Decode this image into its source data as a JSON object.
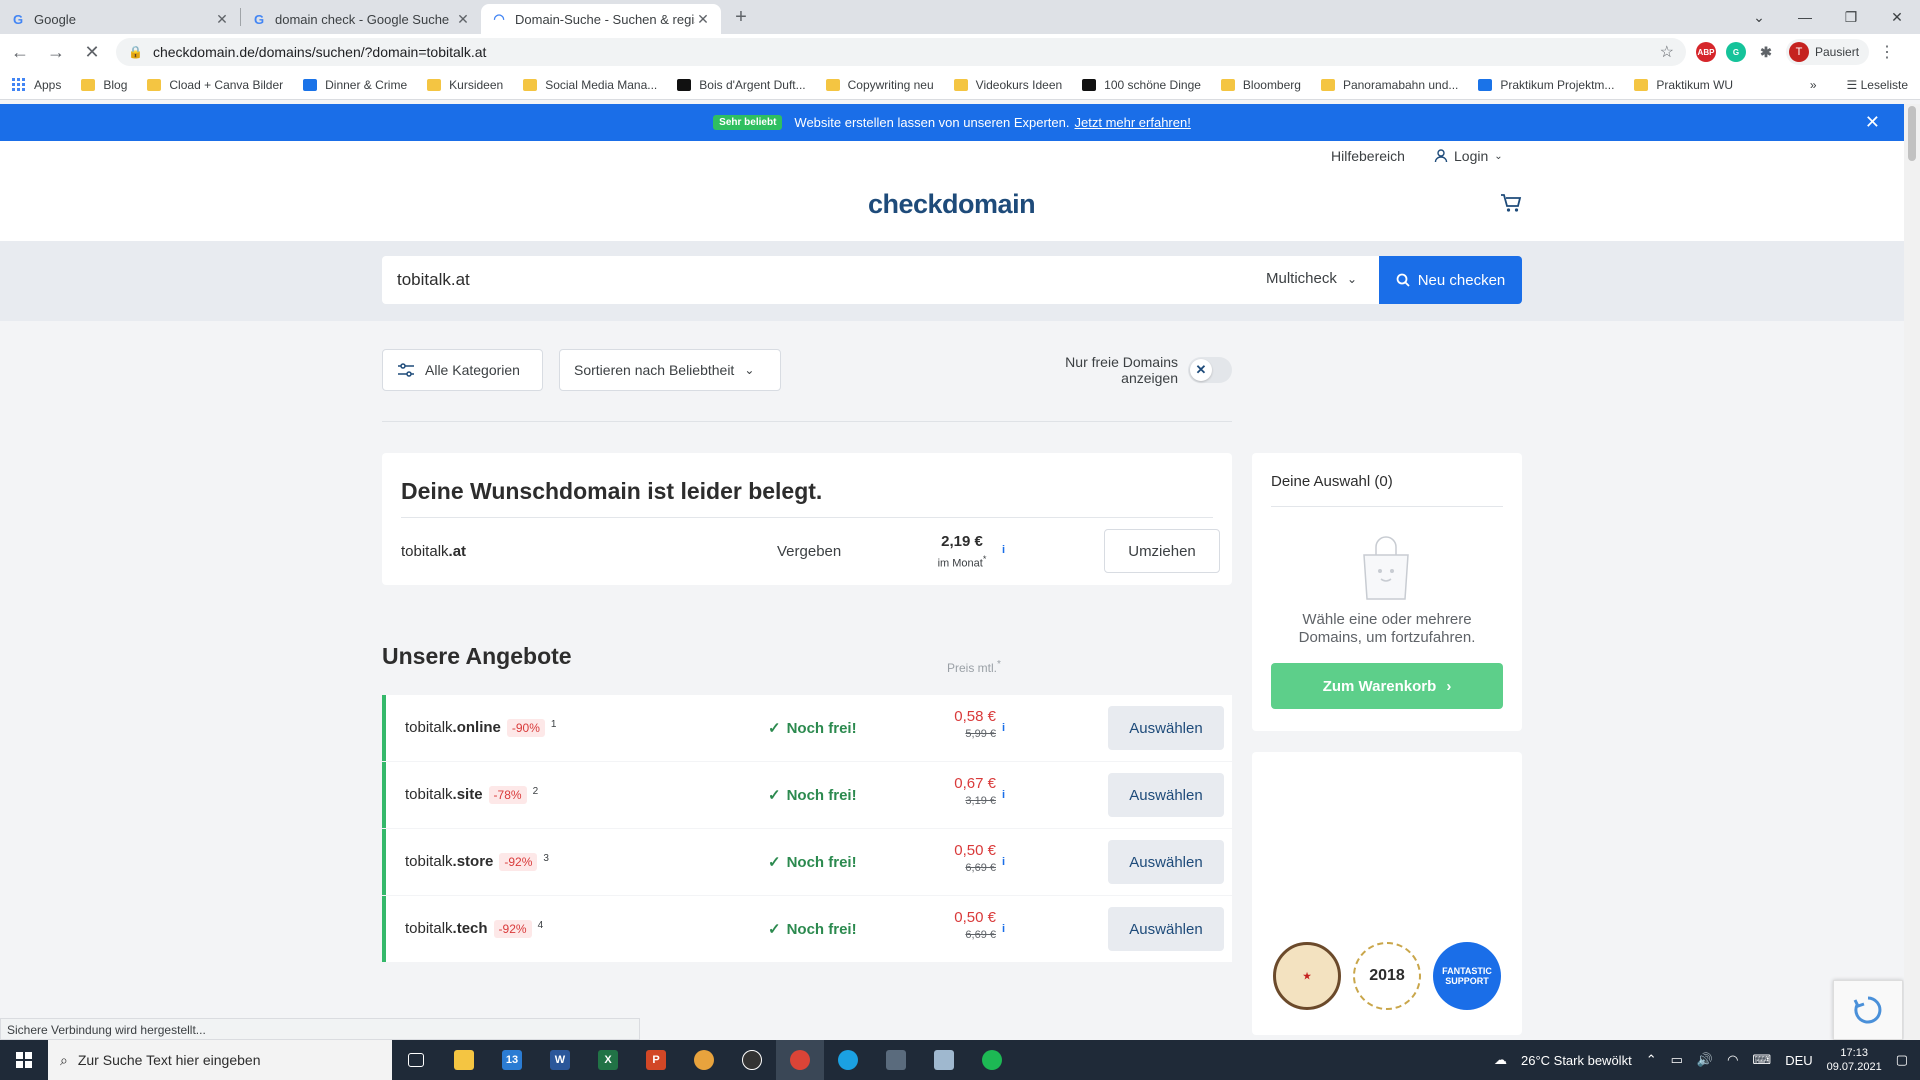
{
  "browser": {
    "tabs": [
      {
        "title": "Google",
        "icon": "google-icon"
      },
      {
        "title": "domain check - Google Suche",
        "icon": "google-icon"
      },
      {
        "title": "Domain-Suche - Suchen & regist",
        "icon": "loading-icon"
      }
    ],
    "url": "checkdomain.de/domains/suchen/?domain=tobitalk.at",
    "profile_label": "Pausiert",
    "profile_initial": "T",
    "bookmarks": [
      "Apps",
      "Blog",
      "Cload + Canva Bilder",
      "Dinner & Crime",
      "Kursideen",
      "Social Media Mana...",
      "Bois d'Argent Duft...",
      "Copywriting neu",
      "Videokurs Ideen",
      "100 schöne Dinge",
      "Bloomberg",
      "Panoramabahn und...",
      "Praktikum Projektm...",
      "Praktikum WU"
    ],
    "reading_list": "Leseliste",
    "status_text": "Sichere Verbindung wird hergestellt..."
  },
  "promo": {
    "badge": "Sehr beliebt",
    "text": "Website erstellen lassen von unseren Experten.",
    "link": "Jetzt mehr erfahren!"
  },
  "util": {
    "help": "Hilfebereich",
    "login": "Login"
  },
  "logo": "checkdomain",
  "search": {
    "value": "tobitalk.at",
    "mode": "Multicheck",
    "button": "Neu checken"
  },
  "filters": {
    "categories": "Alle Kategorien",
    "sort": "Sortieren nach Beliebtheit",
    "free_only": "Nur freie Domains anzeigen"
  },
  "taken": {
    "heading": "Deine Wunschdomain ist leider belegt.",
    "domain_name": "tobitalk",
    "domain_tld": ".at",
    "status": "Vergeben",
    "price": "2,19 €",
    "period": "im Monat",
    "button": "Umziehen"
  },
  "offers": {
    "heading": "Unsere Angebote",
    "price_header": "Preis mtl.",
    "items": [
      {
        "name": "tobitalk",
        "tld": ".online",
        "discount": "-90%",
        "fn": "1",
        "status": "Noch frei!",
        "price": "0,58 €",
        "old_price": "5,99 €",
        "button": "Auswählen"
      },
      {
        "name": "tobitalk",
        "tld": ".site",
        "discount": "-78%",
        "fn": "2",
        "status": "Noch frei!",
        "price": "0,67 €",
        "old_price": "3,19 €",
        "button": "Auswählen"
      },
      {
        "name": "tobitalk",
        "tld": ".store",
        "discount": "-92%",
        "fn": "3",
        "status": "Noch frei!",
        "price": "0,50 €",
        "old_price": "6,69 €",
        "button": "Auswählen"
      },
      {
        "name": "tobitalk",
        "tld": ".tech",
        "discount": "-92%",
        "fn": "4",
        "status": "Noch frei!",
        "price": "0,50 €",
        "old_price": "6,69 €",
        "button": "Auswählen"
      }
    ]
  },
  "selection": {
    "title": "Deine Auswahl (0)",
    "hint": "Wähle eine oder mehrere Domains, um fortzufahren.",
    "button": "Zum Warenkorb"
  },
  "seals": {
    "year": "2018",
    "support": "FANTASTIC SUPPORT"
  },
  "taskbar": {
    "search_placeholder": "Zur Suche Text hier eingeben",
    "weather": "26°C  Stark bewölkt",
    "lang": "DEU",
    "time": "17:13",
    "date": "09.07.2021",
    "mail_badge": "13"
  },
  "colors": {
    "brand_blue": "#1a6ee8",
    "free_green": "#34b86a",
    "discount_red": "#d93a3a"
  }
}
